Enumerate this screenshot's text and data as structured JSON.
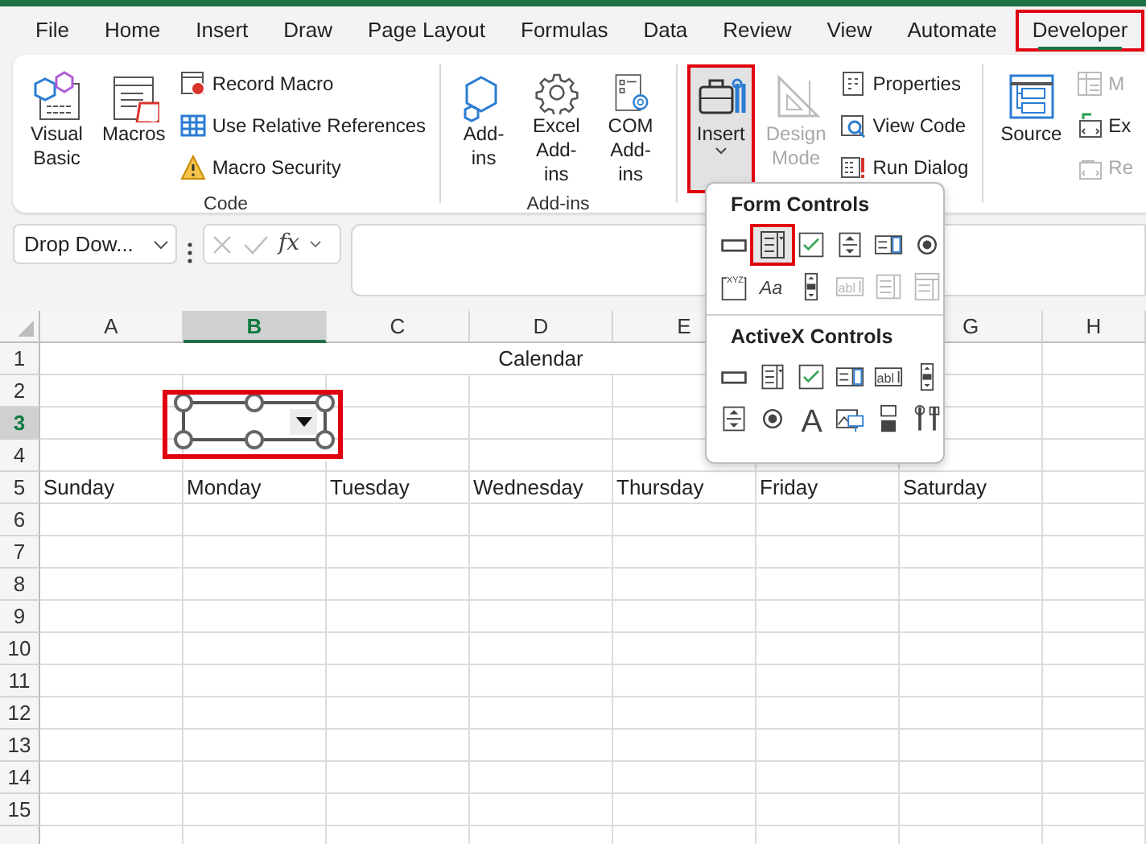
{
  "ribbon_tabs": [
    {
      "label": "File",
      "selected": false,
      "highlighted": false
    },
    {
      "label": "Home",
      "selected": false,
      "highlighted": false
    },
    {
      "label": "Insert",
      "selected": false,
      "highlighted": false
    },
    {
      "label": "Draw",
      "selected": false,
      "highlighted": false
    },
    {
      "label": "Page Layout",
      "selected": false,
      "highlighted": false
    },
    {
      "label": "Formulas",
      "selected": false,
      "highlighted": false
    },
    {
      "label": "Data",
      "selected": false,
      "highlighted": false
    },
    {
      "label": "Review",
      "selected": false,
      "highlighted": false
    },
    {
      "label": "View",
      "selected": false,
      "highlighted": false
    },
    {
      "label": "Automate",
      "selected": false,
      "highlighted": false
    },
    {
      "label": "Developer",
      "selected": true,
      "highlighted": true
    }
  ],
  "ribbon_groups": [
    {
      "label": "Code",
      "items": [
        {
          "kind": "large",
          "label": "Visual Basic",
          "disabled": false,
          "pressed": false,
          "highlighted": false
        },
        {
          "kind": "large",
          "label": "Macros",
          "disabled": false,
          "pressed": false,
          "highlighted": false
        },
        {
          "kind": "small",
          "label": "Record Macro",
          "disabled": false
        },
        {
          "kind": "small",
          "label": "Use Relative References",
          "disabled": false
        },
        {
          "kind": "small",
          "label": "Macro Security",
          "disabled": false
        }
      ]
    },
    {
      "label": "Add-ins",
      "items": [
        {
          "kind": "large",
          "label": "Add-ins",
          "disabled": false,
          "pressed": false,
          "highlighted": false
        },
        {
          "kind": "large",
          "label": "Excel Add-ins",
          "disabled": false,
          "pressed": false,
          "highlighted": false
        },
        {
          "kind": "large",
          "label": "COM Add-ins",
          "disabled": false,
          "pressed": false,
          "highlighted": false
        }
      ]
    },
    {
      "items": [
        {
          "kind": "large",
          "label": "Insert",
          "disabled": false,
          "pressed": true,
          "highlighted": true,
          "dropdown": true
        },
        {
          "kind": "large",
          "label": "Design Mode",
          "disabled": true,
          "pressed": false,
          "highlighted": false
        },
        {
          "kind": "small",
          "label": "Properties",
          "disabled": false
        },
        {
          "kind": "small",
          "label": "View Code",
          "disabled": false
        },
        {
          "kind": "small",
          "label": "Run Dialog",
          "disabled": false
        }
      ]
    },
    {
      "items": [
        {
          "kind": "large",
          "label": "Source",
          "disabled": false,
          "pressed": false,
          "highlighted": false
        },
        {
          "kind": "small",
          "label": "M",
          "disabled": true
        },
        {
          "kind": "small",
          "label": "Ex",
          "disabled": false
        },
        {
          "kind": "small",
          "label": "Re",
          "disabled": true
        }
      ]
    }
  ],
  "formula_bar": {
    "name_box": "Drop Dow...",
    "function_label": "fx"
  },
  "sheet": {
    "columns": [
      {
        "label": "A",
        "selected": false
      },
      {
        "label": "B",
        "selected": true
      },
      {
        "label": "C",
        "selected": false
      },
      {
        "label": "D",
        "selected": false
      },
      {
        "label": "E",
        "selected": false
      },
      {
        "label": "G",
        "selected": false
      },
      {
        "label": "H",
        "selected": false
      }
    ],
    "rows": [
      {
        "number": "1",
        "selected": false,
        "merged_text": "Calendar"
      },
      {
        "number": "2",
        "selected": false
      },
      {
        "number": "3",
        "selected": true
      },
      {
        "number": "4",
        "selected": false
      },
      {
        "number": "5",
        "selected": false,
        "cells": [
          "Sunday",
          "Monday",
          "Tuesday",
          "Wednesday",
          "Thursday",
          "Friday",
          "Saturday"
        ]
      },
      {
        "number": "6",
        "selected": false
      },
      {
        "number": "7",
        "selected": false
      },
      {
        "number": "8",
        "selected": false
      },
      {
        "number": "9",
        "selected": false
      },
      {
        "number": "10",
        "selected": false
      },
      {
        "number": "11",
        "selected": false
      },
      {
        "number": "12",
        "selected": false
      },
      {
        "number": "13",
        "selected": false
      },
      {
        "number": "14",
        "selected": false
      },
      {
        "number": "15",
        "selected": false
      }
    ],
    "form_control": {
      "kind": "combo",
      "selected": true,
      "highlighted": true
    }
  },
  "insert_menu": [
    {
      "title": "Form Controls",
      "items": [
        {
          "kind": "button",
          "selected": false,
          "disabled": false,
          "highlighted": false
        },
        {
          "kind": "combo",
          "selected": true,
          "disabled": false,
          "highlighted": true
        },
        {
          "kind": "checkbox",
          "selected": false,
          "disabled": false,
          "highlighted": false
        },
        {
          "kind": "spin",
          "selected": false,
          "disabled": false,
          "highlighted": false
        },
        {
          "kind": "listbox",
          "selected": false,
          "disabled": false,
          "highlighted": false
        },
        {
          "kind": "option",
          "selected": false,
          "disabled": false,
          "highlighted": false
        },
        {
          "kind": "groupbox",
          "glyph": "XYZ",
          "selected": false,
          "disabled": false,
          "highlighted": false
        },
        {
          "kind": "label",
          "glyph": "Aa",
          "selected": false,
          "disabled": false,
          "highlighted": false
        },
        {
          "kind": "scrollbar",
          "selected": false,
          "disabled": false,
          "highlighted": false
        },
        {
          "kind": "textfield",
          "glyph": "abl",
          "selected": false,
          "disabled": true,
          "highlighted": false
        },
        {
          "kind": "combolist",
          "selected": false,
          "disabled": true,
          "highlighted": false
        },
        {
          "kind": "combodrop",
          "selected": false,
          "disabled": true,
          "highlighted": false
        }
      ]
    },
    {
      "title": "ActiveX Controls",
      "items": [
        {
          "kind": "button",
          "selected": false,
          "disabled": false,
          "highlighted": false
        },
        {
          "kind": "combo",
          "selected": false,
          "disabled": false,
          "highlighted": false
        },
        {
          "kind": "checkbox",
          "selected": false,
          "disabled": false,
          "highlighted": false
        },
        {
          "kind": "listbox",
          "selected": false,
          "disabled": false,
          "highlighted": false
        },
        {
          "kind": "textfield",
          "glyph": "abl",
          "selected": false,
          "disabled": false,
          "highlighted": false
        },
        {
          "kind": "scrollbar",
          "selected": false,
          "disabled": false,
          "highlighted": false
        },
        {
          "kind": "spin",
          "selected": false,
          "disabled": false,
          "highlighted": false
        },
        {
          "kind": "option",
          "selected": false,
          "disabled": false,
          "highlighted": false
        },
        {
          "kind": "biglabel",
          "glyph": "A",
          "selected": false,
          "disabled": false,
          "highlighted": false
        },
        {
          "kind": "image",
          "selected": false,
          "disabled": false,
          "highlighted": false
        },
        {
          "kind": "toggle",
          "selected": false,
          "disabled": false,
          "highlighted": false
        },
        {
          "kind": "more",
          "selected": false,
          "disabled": false,
          "highlighted": false
        }
      ]
    }
  ]
}
